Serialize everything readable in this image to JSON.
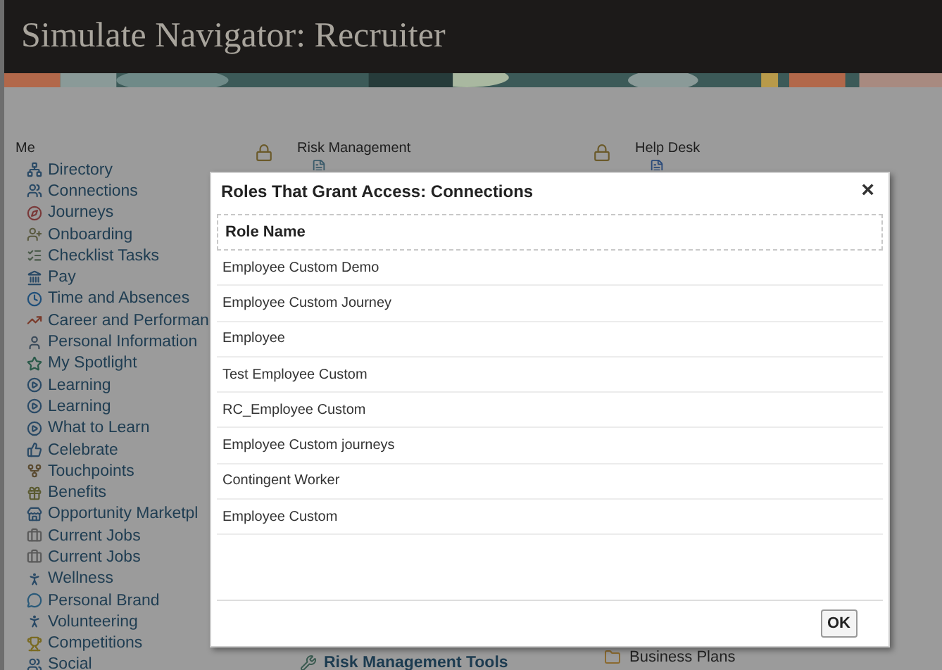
{
  "window": {
    "title": "Simulate Navigator: Recruiter"
  },
  "me": {
    "heading": "Me",
    "items": [
      {
        "label": "Directory"
      },
      {
        "label": "Connections"
      },
      {
        "label": "Journeys"
      },
      {
        "label": "Onboarding"
      },
      {
        "label": "Checklist Tasks"
      },
      {
        "label": "Pay"
      },
      {
        "label": "Time and Absences"
      },
      {
        "label": "Career and Performan"
      },
      {
        "label": "Personal Information"
      },
      {
        "label": "My Spotlight"
      },
      {
        "label": "Learning"
      },
      {
        "label": "Learning"
      },
      {
        "label": "What to Learn"
      },
      {
        "label": "Celebrate"
      },
      {
        "label": "Touchpoints"
      },
      {
        "label": "Benefits"
      },
      {
        "label": "Opportunity Marketpl"
      },
      {
        "label": "Current Jobs"
      },
      {
        "label": "Current Jobs"
      },
      {
        "label": "Wellness"
      },
      {
        "label": "Personal Brand"
      },
      {
        "label": "Volunteering"
      },
      {
        "label": "Competitions"
      },
      {
        "label": "Social"
      }
    ]
  },
  "risk_management": {
    "heading": "Risk Management",
    "tools_link": "Risk Management Tools"
  },
  "help_desk": {
    "heading": "Help Desk",
    "business_plans": "Business Plans"
  },
  "dialog": {
    "title": "Roles That Grant Access: Connections",
    "close": "×",
    "column": "Role Name",
    "rows": [
      "Employee Custom Demo",
      "Employee Custom Journey",
      "Employee",
      "Test Employee Custom",
      "RC_Employee Custom",
      "Employee Custom journeys",
      "Contingent Worker",
      "Employee Custom"
    ],
    "ok": "OK"
  }
}
